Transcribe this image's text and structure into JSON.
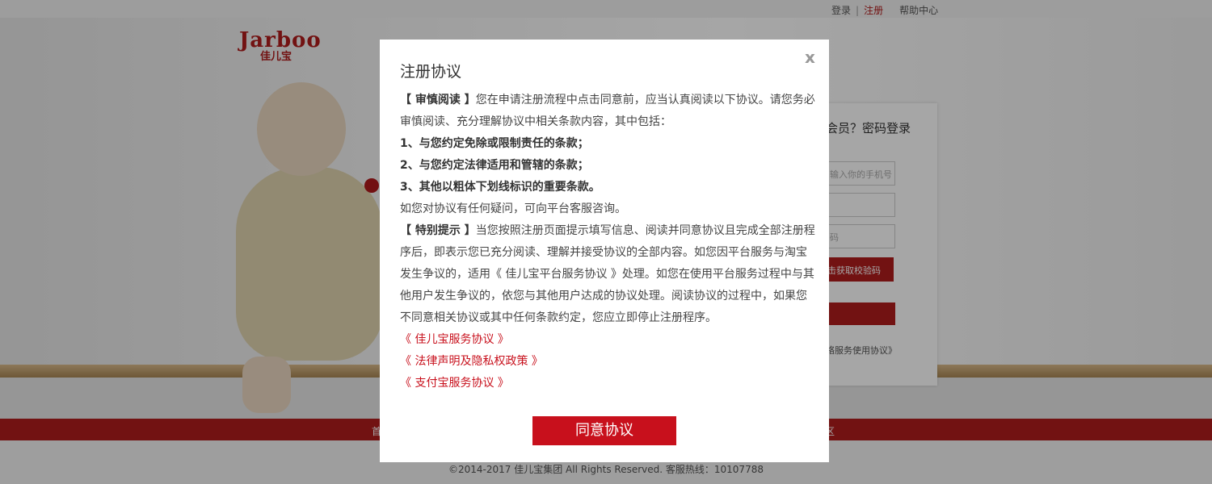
{
  "topbar": {
    "login": "登录",
    "separator": "|",
    "register": "注册",
    "help": "帮助中心"
  },
  "logo": {
    "en": "Jarboo",
    "cn": "佳儿宝"
  },
  "register_panel": {
    "title": "会员？密码登录",
    "phone_placeholder": "输入你的手机号",
    "field_two": "",
    "field_three": "码",
    "code_button": "击获取校验码",
    "agreement_note": "络服务使用协议》"
  },
  "nav": {
    "left_fragment": "首",
    "right_fragment": "区"
  },
  "footer": {
    "copyright": "©2014-2017 佳儿宝集团 All Rights Reserved. 客服热线：10107788"
  },
  "modal": {
    "close": "x",
    "title": "注册协议",
    "p1_label": "【 审慎阅读 】",
    "p1_text": "您在申请注册流程中点击同意前，应当认真阅读以下协议。请您务必审慎阅读、充分理解协议中相关条款内容，其中包括：",
    "item1": "1、与您约定免除或限制责任的条款；",
    "item2": "2、与您约定法律适用和管辖的条款；",
    "item3": "3、其他以粗体下划线标识的重要条款。",
    "p2": "如您对协议有任何疑问，可向平台客服咨询。",
    "p3_label": "【 特别提示 】",
    "p3_text": "当您按照注册页面提示填写信息、阅读并同意协议且完成全部注册程序后，即表示您已充分阅读、理解并接受协议的全部内容。如您因平台服务与淘宝发生争议的，适用《 佳儿宝平台服务协议 》处理。如您在使用平台服务过程中与其他用户发生争议的，依您与其他用户达成的协议处理。阅读协议的过程中，如果您不同意相关协议或其中任何条款约定，您应立即停止注册程序。",
    "links": [
      "《 佳儿宝服务协议 》",
      "《 法律声明及隐私权政策 》",
      "《 支付宝服务协议 》"
    ],
    "agree_button": "同意协议"
  },
  "colors": {
    "brand_red": "#b01c1c",
    "button_red": "#c8101c"
  }
}
